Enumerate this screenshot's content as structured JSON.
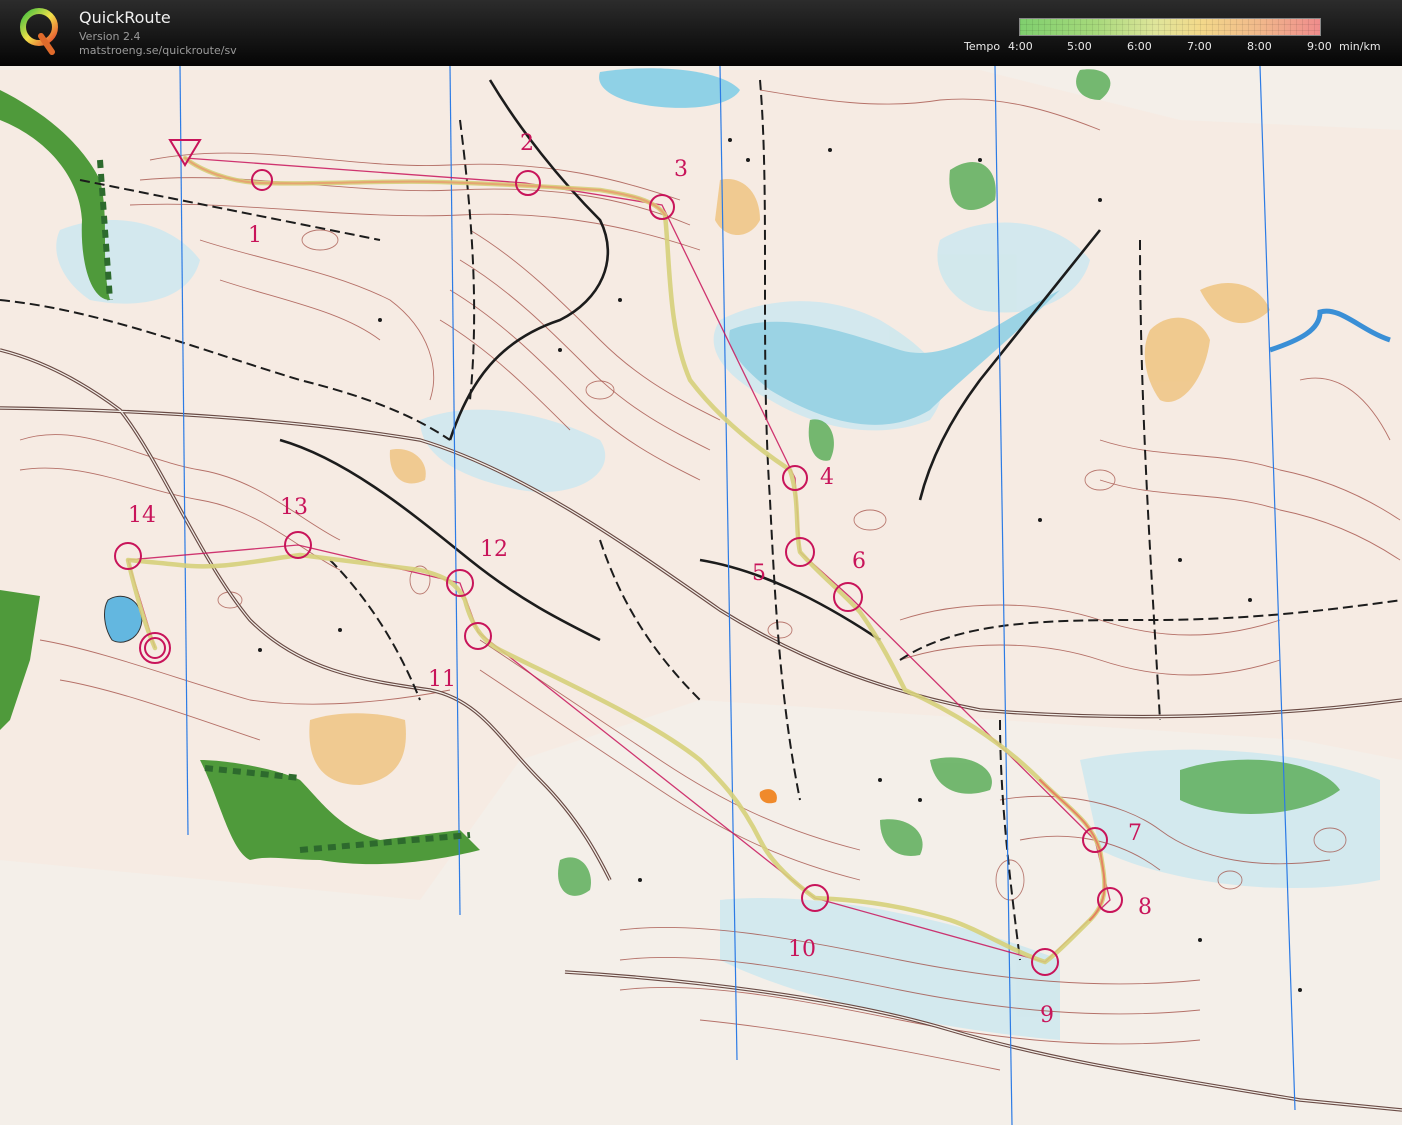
{
  "app": {
    "name": "QuickRoute",
    "version": "Version 2.4",
    "url": "matstroeng.se/quickroute/sv",
    "logo_letter": "Q"
  },
  "tempo_legend": {
    "label": "Tempo",
    "ticks": [
      "4:00",
      "5:00",
      "6:00",
      "7:00",
      "8:00",
      "9:00"
    ],
    "unit": "min/km",
    "colors": [
      "#7fcf6e",
      "#dfe59a",
      "#f3d98a",
      "#ef8c8c"
    ]
  },
  "map": {
    "colors": {
      "background": "#f4efe9",
      "contour": "#a0483f",
      "course": "#c8145a",
      "route": "#d3c96b",
      "water": "#8fd1e6",
      "green": "#5dae5a",
      "yellow": "#f0c787",
      "road": "#6a4b45",
      "meridian": "#2c7be5"
    },
    "controls": [
      "1",
      "2",
      "3",
      "4",
      "5",
      "6",
      "7",
      "8",
      "9",
      "10",
      "11",
      "12",
      "13",
      "14"
    ]
  }
}
